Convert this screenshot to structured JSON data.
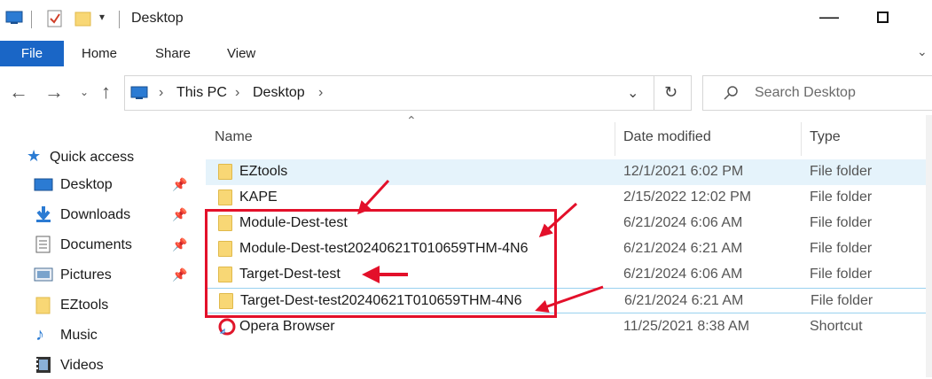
{
  "window": {
    "title": "Desktop"
  },
  "ribbon": {
    "tabs": [
      "File",
      "Home",
      "Share",
      "View"
    ]
  },
  "address": {
    "crumbs": [
      "This PC",
      "Desktop"
    ],
    "search_placeholder": "Search Desktop"
  },
  "columns": {
    "name": "Name",
    "date": "Date modified",
    "type": "Type"
  },
  "nav": {
    "quick_access": "Quick access",
    "items": [
      {
        "label": "Desktop",
        "icon": "desktop-icon",
        "pinned": true
      },
      {
        "label": "Downloads",
        "icon": "download-icon",
        "pinned": true
      },
      {
        "label": "Documents",
        "icon": "documents-icon",
        "pinned": true
      },
      {
        "label": "Pictures",
        "icon": "pictures-icon",
        "pinned": true
      },
      {
        "label": "EZtools",
        "icon": "folder-icon",
        "pinned": false
      },
      {
        "label": "Music",
        "icon": "music-icon",
        "pinned": false
      },
      {
        "label": "Videos",
        "icon": "videos-icon",
        "pinned": false
      }
    ]
  },
  "files": [
    {
      "name": "EZtools",
      "date": "12/1/2021 6:02 PM",
      "type": "File folder"
    },
    {
      "name": "KAPE",
      "date": "2/15/2022 12:02 PM",
      "type": "File folder"
    },
    {
      "name": "Module-Dest-test",
      "date": "6/21/2024 6:06 AM",
      "type": "File folder"
    },
    {
      "name": "Module-Dest-test20240621T010659THM-4N6",
      "date": "6/21/2024 6:21 AM",
      "type": "File folder"
    },
    {
      "name": "Target-Dest-test",
      "date": "6/21/2024 6:06 AM",
      "type": "File folder"
    },
    {
      "name": "Target-Dest-test20240621T010659THM-4N6",
      "date": "6/21/2024 6:21 AM",
      "type": "File folder"
    },
    {
      "name": "Opera Browser",
      "date": "11/25/2021 8:38 AM",
      "type": "Shortcut"
    }
  ],
  "colors": {
    "accent": "#1a66c6",
    "annotation": "#e3102a",
    "selection": "#e5f3fb",
    "folder": "#f8d775"
  }
}
